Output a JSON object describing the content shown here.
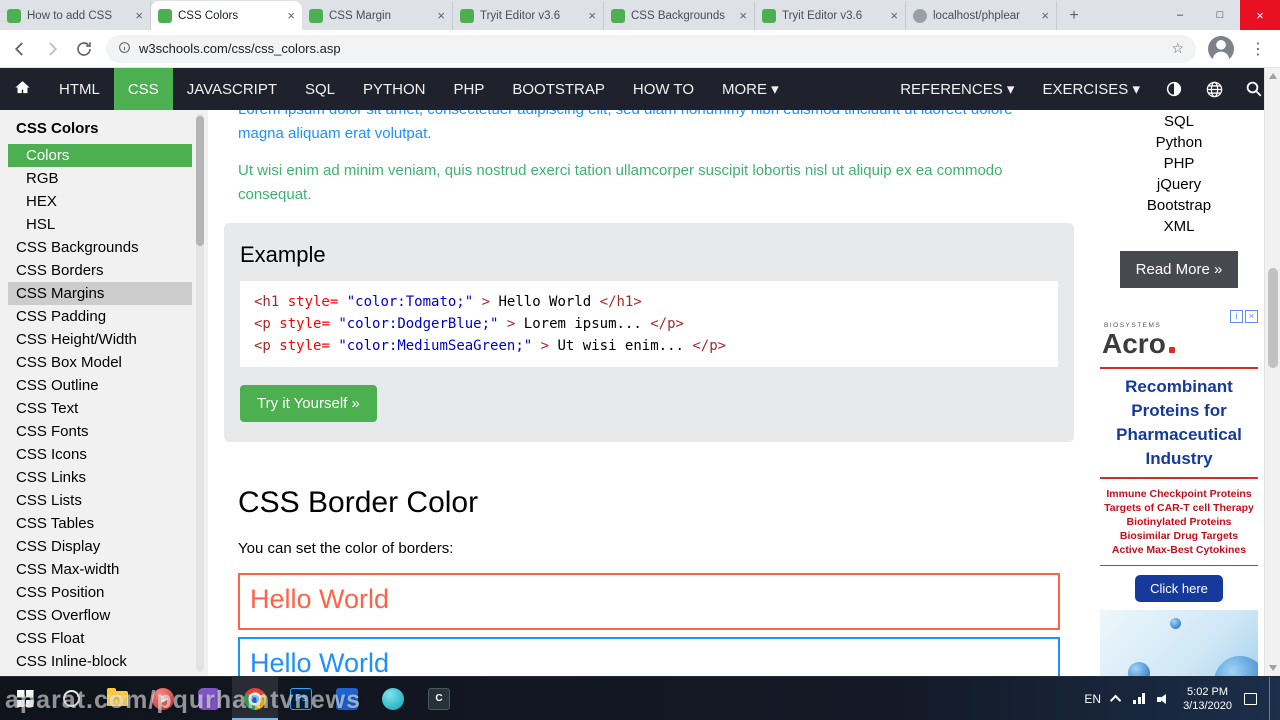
{
  "browser": {
    "tabs": [
      {
        "title": "How to add CSS",
        "close": "×",
        "favicon": "w3schools",
        "cls": ""
      },
      {
        "title": "CSS Colors",
        "close": "×",
        "favicon": "w3schools",
        "cls": "active"
      },
      {
        "title": "CSS Margin",
        "close": "×",
        "favicon": "w3schools",
        "cls": ""
      },
      {
        "title": "Tryit Editor v3.6",
        "close": "×",
        "favicon": "w3schools",
        "cls": ""
      },
      {
        "title": "CSS Backgrounds",
        "close": "×",
        "favicon": "w3schools",
        "cls": ""
      },
      {
        "title": "Tryit Editor v3.6",
        "close": "×",
        "favicon": "w3schools",
        "cls": ""
      },
      {
        "title": "localhost/phplear",
        "close": "×",
        "favicon": "localhost",
        "cls": ""
      }
    ],
    "new_tab_label": "+",
    "window_controls": {
      "minimize": "–",
      "maximize": "□",
      "close": "×"
    },
    "url": "w3schools.com/css/css_colors.asp",
    "icons": {
      "star": "☆",
      "menu": "⋮"
    }
  },
  "topnav": {
    "items": [
      {
        "label": "HTML",
        "cls": ""
      },
      {
        "label": "CSS",
        "cls": "active"
      },
      {
        "label": "JAVASCRIPT",
        "cls": ""
      },
      {
        "label": "SQL",
        "cls": ""
      },
      {
        "label": "PYTHON",
        "cls": ""
      },
      {
        "label": "PHP",
        "cls": ""
      },
      {
        "label": "BOOTSTRAP",
        "cls": ""
      },
      {
        "label": "HOW TO",
        "cls": ""
      },
      {
        "label": "MORE ▾",
        "cls": ""
      }
    ],
    "right_items": [
      {
        "label": "REFERENCES ▾",
        "cls": ""
      },
      {
        "label": "EXERCISES ▾",
        "cls": ""
      }
    ],
    "icon_names": [
      "home-icon",
      "contrast-icon",
      "globe-icon",
      "search-icon"
    ]
  },
  "sidebar": {
    "title": "CSS Colors",
    "items": [
      {
        "label": "Colors",
        "cls": "indent active"
      },
      {
        "label": "RGB",
        "cls": "indent"
      },
      {
        "label": "HEX",
        "cls": "indent"
      },
      {
        "label": "HSL",
        "cls": "indent"
      },
      {
        "label": "CSS Backgrounds",
        "cls": ""
      },
      {
        "label": "CSS Borders",
        "cls": ""
      },
      {
        "label": "CSS Margins",
        "cls": "hovered"
      },
      {
        "label": "CSS Padding",
        "cls": ""
      },
      {
        "label": "CSS Height/Width",
        "cls": ""
      },
      {
        "label": "CSS Box Model",
        "cls": ""
      },
      {
        "label": "CSS Outline",
        "cls": ""
      },
      {
        "label": "CSS Text",
        "cls": ""
      },
      {
        "label": "CSS Fonts",
        "cls": ""
      },
      {
        "label": "CSS Icons",
        "cls": ""
      },
      {
        "label": "CSS Links",
        "cls": ""
      },
      {
        "label": "CSS Lists",
        "cls": ""
      },
      {
        "label": "CSS Tables",
        "cls": ""
      },
      {
        "label": "CSS Display",
        "cls": ""
      },
      {
        "label": "CSS Max-width",
        "cls": ""
      },
      {
        "label": "CSS Position",
        "cls": ""
      },
      {
        "label": "CSS Overflow",
        "cls": ""
      },
      {
        "label": "CSS Float",
        "cls": ""
      },
      {
        "label": "CSS Inline-block",
        "cls": ""
      }
    ]
  },
  "content": {
    "intro_paragraphs": [
      {
        "text": "Lorem ipsum dolor sit amet, consectetuer adipiscing elit, sed diam nonummy nibh euismod tincidunt ut laoreet dolore magna aliquam erat volutpat.",
        "style": "color:#1E90FF"
      },
      {
        "text": "Ut wisi enim ad minim veniam, quis nostrud exerci tation ullamcorper suscipit lobortis nisl ut aliquip ex ea commodo consequat.",
        "style": "color:#3CB371"
      }
    ],
    "example": {
      "heading": "Example",
      "code_lines": [
        {
          "segments": [
            {
              "text": "<h1 ",
              "cls": "c-tag"
            },
            {
              "text": "style=",
              "cls": "c-attr"
            },
            {
              "text": "\"color:Tomato;\"",
              "cls": "c-val"
            },
            {
              "text": ">",
              "cls": "c-tag"
            },
            {
              "text": "Hello World",
              "cls": "c-plain"
            },
            {
              "text": "</h1>",
              "cls": "c-tag"
            }
          ]
        },
        {
          "segments": [
            {
              "text": "<p ",
              "cls": "c-tag"
            },
            {
              "text": "style=",
              "cls": "c-attr"
            },
            {
              "text": "\"color:DodgerBlue;\"",
              "cls": "c-val"
            },
            {
              "text": ">",
              "cls": "c-tag"
            },
            {
              "text": "Lorem ipsum...",
              "cls": "c-plain"
            },
            {
              "text": "</p>",
              "cls": "c-tag"
            }
          ]
        },
        {
          "segments": [
            {
              "text": "<p ",
              "cls": "c-tag"
            },
            {
              "text": "style=",
              "cls": "c-attr"
            },
            {
              "text": "\"color:MediumSeaGreen;\"",
              "cls": "c-val"
            },
            {
              "text": ">",
              "cls": "c-tag"
            },
            {
              "text": "Ut wisi enim...",
              "cls": "c-plain"
            },
            {
              "text": "</p>",
              "cls": "c-tag"
            }
          ]
        }
      ],
      "try_button": "Try it Yourself »"
    },
    "section_heading": "CSS Border Color",
    "section_text": "You can set the color of borders:",
    "demo_boxes": [
      {
        "text": "Hello World",
        "style": "color:#FF6347;border-color:#FF6347"
      },
      {
        "text": "Hello World",
        "style": "color:#1E90FF;border-color:#1E90FF"
      }
    ]
  },
  "right_sidebar": {
    "links": [
      "SQL",
      "Python",
      "PHP",
      "jQuery",
      "Bootstrap",
      "XML"
    ],
    "read_more": "Read More »",
    "ad": {
      "info_glyph": "i",
      "close_glyph": "×",
      "brand_sub": "BIOSYSTEMS",
      "brand": "Acro",
      "headline": "Recombinant Proteins for Pharmaceutical Industry",
      "bullets": [
        "Immune Checkpoint Proteins",
        "Targets of CAR-T cell Therapy",
        "Biotinylated Proteins",
        "Biosimilar Drug Targets",
        "Active Max-Best Cytokines"
      ],
      "cta": "Click here"
    }
  },
  "taskbar": {
    "apps": [
      {
        "name": "start-button"
      },
      {
        "name": "cortana-search-icon"
      },
      {
        "name": "file-explorer-icon"
      },
      {
        "name": "media-player-icon"
      },
      {
        "name": "video-player-icon"
      },
      {
        "name": "chrome-icon"
      },
      {
        "name": "photoshop-icon",
        "glyph": "Ps"
      },
      {
        "name": "dreamweaver-icon"
      },
      {
        "name": "messenger-icon"
      },
      {
        "name": "c-editor-icon",
        "glyph": "C"
      }
    ],
    "tray_lang": "EN",
    "time": "5:02 PM",
    "date": "3/13/2020",
    "tray_icon_names": [
      "chevron-up-icon",
      "network-icon",
      "volume-icon",
      "action-center-icon"
    ]
  },
  "watermark": "aparat.com/pqurhamtvnews",
  "theme": {
    "w3_green": "#4CAF50",
    "topnav_bg": "#1f222c",
    "tomato": "#FF6347",
    "dodger_blue": "#1E90FF",
    "medium_sea_green": "#3CB371",
    "ad_blue": "#16399C",
    "ad_red": "#D62E20",
    "close_red": "#E81123"
  }
}
